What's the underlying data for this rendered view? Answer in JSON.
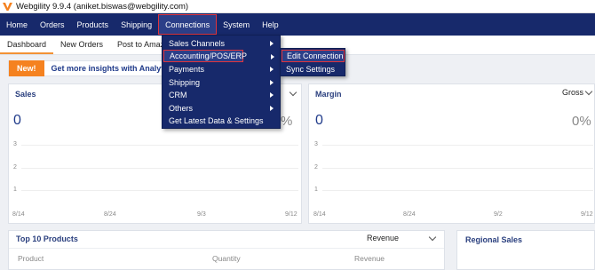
{
  "window": {
    "title": "Webgility 9.9.4 (aniket.biswas@webgility.com)",
    "logo_icon": "webgility-logo-icon"
  },
  "menubar": {
    "items": [
      "Home",
      "Orders",
      "Products",
      "Shipping",
      "Connections",
      "System",
      "Help"
    ],
    "active": "Connections"
  },
  "tabs": {
    "items": [
      "Dashboard",
      "New Orders",
      "Post to Amazon"
    ],
    "active": "Dashboard"
  },
  "banner": {
    "badge": "New!",
    "text": "Get more insights with Analyt"
  },
  "sales_card": {
    "title": "Sales",
    "value": "0",
    "percent": "%",
    "y_ticks": [
      "3",
      "2",
      "1"
    ],
    "x_ticks": [
      "8/14",
      "8/24",
      "9/3",
      "9/12"
    ]
  },
  "margin_card": {
    "title": "Margin",
    "dropdown": "Gross",
    "value": "0",
    "percent": "0%",
    "y_ticks": [
      "3",
      "2",
      "1"
    ],
    "x_ticks": [
      "8/14",
      "8/24",
      "9/2",
      "9/12"
    ]
  },
  "top_products": {
    "title": "Top 10 Products",
    "dropdown": "Revenue",
    "columns": [
      "Product",
      "Quantity",
      "Revenue"
    ]
  },
  "regional_sales": {
    "title": "Regional Sales"
  },
  "connections_menu": {
    "items": [
      "Sales Channels",
      "Accounting/POS/ERP",
      "Payments",
      "Shipping",
      "CRM",
      "Others",
      "Get Latest Data & Settings"
    ],
    "highlighted": "Accounting/POS/ERP"
  },
  "accounting_submenu": {
    "items": [
      "Edit Connection",
      "Sync Settings"
    ],
    "highlighted": "Edit Connection"
  },
  "colors": {
    "menubar": "#17296b",
    "accent": "#f58220",
    "highlight_border": "#e0353d",
    "title_blue": "#2a3f7e"
  }
}
